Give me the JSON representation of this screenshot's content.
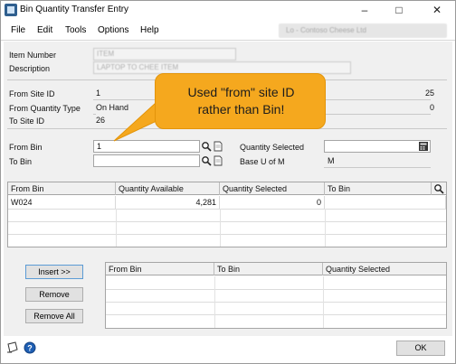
{
  "window": {
    "title": "Bin Quantity Transfer Entry",
    "controls": [
      "–",
      "□",
      "✕"
    ]
  },
  "menu": {
    "items": [
      "File",
      "Edit",
      "Tools",
      "Options",
      "Help"
    ],
    "context_placeholder": "Lo - Contoso Cheese Ltd"
  },
  "header": {
    "item_number_label": "Item Number",
    "item_number_value": "ITEM",
    "description_label": "Description",
    "description_value": "LAPTOP TO CHEE ITEM"
  },
  "site": {
    "from_site_label": "From Site ID",
    "from_site_value": "1",
    "from_site_right": "25",
    "from_qty_type_label": "From Quantity Type",
    "from_qty_type_value": "On Hand",
    "from_qty_type_right": "0",
    "to_site_label": "To Site ID",
    "to_site_value": "26"
  },
  "bins": {
    "from_bin_label": "From Bin",
    "from_bin_value": "1",
    "to_bin_label": "To Bin",
    "to_bin_value": "",
    "qty_selected_label": "Quantity Selected",
    "qty_selected_value": "",
    "base_uom_label": "Base U of M",
    "base_uom_value": "M"
  },
  "upper_grid": {
    "columns": [
      "From Bin",
      "Quantity Available",
      "Quantity Selected",
      "To Bin"
    ],
    "rows": [
      {
        "from_bin": "W024",
        "qty_available": "4,281",
        "qty_selected": "0",
        "to_bin": ""
      }
    ]
  },
  "actions": {
    "insert_label": "Insert >>",
    "remove_label": "Remove",
    "remove_all_label": "Remove All"
  },
  "lower_grid": {
    "columns": [
      "From Bin",
      "To Bin",
      "Quantity Selected"
    ]
  },
  "callout": {
    "line1": "Used \"from\" site ID",
    "line2": "rather than Bin!"
  },
  "footer": {
    "ok_label": "OK"
  }
}
